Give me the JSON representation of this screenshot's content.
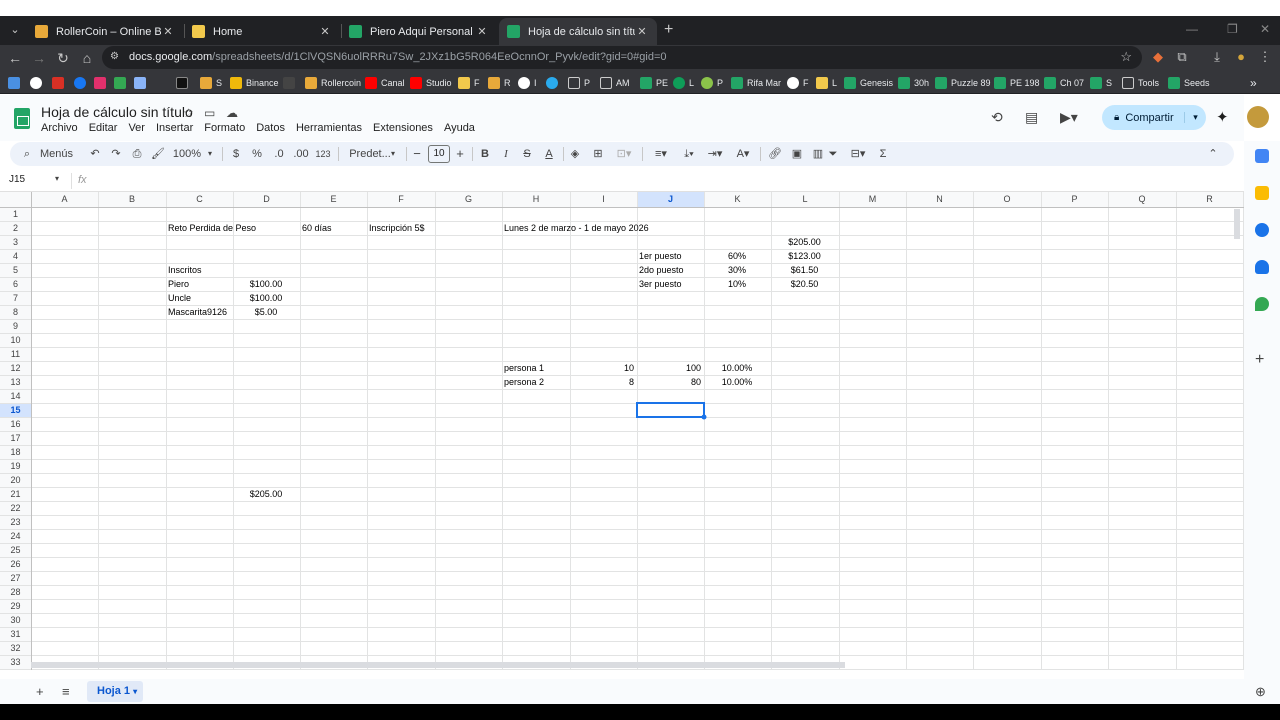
{
  "browser": {
    "tabs": [
      {
        "title": "RollerCoin – Online Bitcoin Mining Game",
        "favicon": "rollercoin-icon",
        "active": false
      },
      {
        "title": "Home",
        "favicon": "home-icon",
        "active": false
      },
      {
        "title": "Piero Adqui Personal - Hojas de cálculo",
        "favicon": "sheets-icon",
        "active": false
      },
      {
        "title": "Hoja de cálculo sin título - Hojas de cálculo",
        "favicon": "sheets-icon",
        "active": true
      }
    ],
    "url_host": "docs.google.com",
    "url_path": "/spreadsheets/d/1ClVQSN6uolRRRu7Sw_2JXz1bG5R064EeOcnnOr_Pyvk/edit?gid=0#gid=0",
    "bookmarks": [
      "",
      "",
      "",
      "",
      "",
      "",
      "",
      "",
      "S",
      "Binance",
      "",
      "Rollercoin",
      "Canal",
      "Studio",
      "F",
      "R",
      "I",
      "",
      "P",
      "AM",
      "PE",
      "L",
      "P",
      "Rifa Mar",
      "F",
      "L",
      "Genesis",
      "30h",
      "Puzzle 89",
      "PE 198",
      "Ch 07",
      "S",
      "Tools",
      "Seeds"
    ]
  },
  "sheets": {
    "doc_title": "Hoja de cálculo sin título",
    "menu": [
      "Archivo",
      "Editar",
      "Ver",
      "Insertar",
      "Formato",
      "Datos",
      "Herramientas",
      "Extensiones",
      "Ayuda"
    ],
    "share_label": "Compartir",
    "toolbar": {
      "menus_label": "Menús",
      "zoom": "100%",
      "currency": "$",
      "percent": "%",
      "dec_decrease": ".0",
      "dec_increase": ".00",
      "number_format": "123",
      "font": "Predet...",
      "font_size": "10"
    },
    "name_box": "J15",
    "fx": "fx",
    "columns": [
      "A",
      "B",
      "C",
      "D",
      "E",
      "F",
      "G",
      "H",
      "I",
      "J",
      "K",
      "L",
      "M",
      "N",
      "O",
      "P",
      "Q",
      "R"
    ],
    "rows": [
      "1",
      "2",
      "3",
      "4",
      "5",
      "6",
      "7",
      "8",
      "9",
      "10",
      "11",
      "12",
      "13",
      "14",
      "15",
      "16",
      "17",
      "18",
      "19",
      "20",
      "21",
      "22",
      "23",
      "24",
      "25",
      "26",
      "27",
      "28",
      "29",
      "30",
      "31",
      "32",
      "33"
    ],
    "cells": {
      "C2": "Reto Perdida de Peso",
      "E2": "60 días",
      "F2": "Inscripción 5$",
      "H2": "Lunes 2 de marzo - 1 de mayo 2026",
      "L3": "$205.00",
      "J4": "1er puesto",
      "K4": "60%",
      "L4": "$123.00",
      "C5": "Inscritos",
      "J5": "2do puesto",
      "K5": "30%",
      "L5": "$61.50",
      "C6": "Piero",
      "D6": "$100.00",
      "J6": "3er puesto",
      "K6": "10%",
      "L6": "$20.50",
      "C7": "Uncle",
      "D7": "$100.00",
      "C8": "Mascarita9126",
      "D8": "$5.00",
      "H12": "persona 1",
      "I12": "10",
      "J12": "100",
      "K12": "10.00%",
      "H13": "persona 2",
      "I13": "8",
      "J13": "80",
      "K13": "10.00%",
      "D21": "$205.00"
    },
    "sheet_tab": "Hoja 1"
  },
  "colors": {
    "selection": "#1a73e8",
    "selected_header": "#d3e3fd",
    "share_bg": "#c2e7ff",
    "sheets_green": "#23a566"
  }
}
